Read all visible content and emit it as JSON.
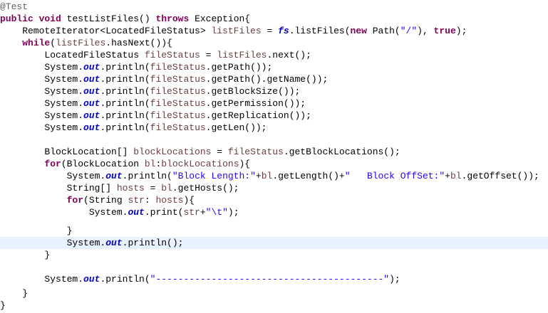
{
  "editor": {
    "highlight_line": 19,
    "lines": [
      [
        [
          "ann",
          "@Test"
        ]
      ],
      [
        [
          "kw",
          "public"
        ],
        [
          "plain",
          " "
        ],
        [
          "kw",
          "void"
        ],
        [
          "plain",
          " testListFiles() "
        ],
        [
          "kw",
          "throws"
        ],
        [
          "plain",
          " Exception{"
        ]
      ],
      [
        [
          "plain",
          "    RemoteIterator<LocatedFileStatus> "
        ],
        [
          "var",
          "listFiles"
        ],
        [
          "plain",
          " = "
        ],
        [
          "fld",
          "fs"
        ],
        [
          "plain",
          ".listFiles("
        ],
        [
          "kw",
          "new"
        ],
        [
          "plain",
          " Path("
        ],
        [
          "str",
          "\"/\""
        ],
        [
          "plain",
          "), "
        ],
        [
          "kw",
          "true"
        ],
        [
          "plain",
          ");"
        ]
      ],
      [
        [
          "plain",
          "    "
        ],
        [
          "kw",
          "while"
        ],
        [
          "plain",
          "("
        ],
        [
          "var",
          "listFiles"
        ],
        [
          "plain",
          ".hasNext()){"
        ]
      ],
      [
        [
          "plain",
          "        LocatedFileStatus "
        ],
        [
          "var",
          "fileStatus"
        ],
        [
          "plain",
          " = "
        ],
        [
          "var",
          "listFiles"
        ],
        [
          "plain",
          ".next();"
        ]
      ],
      [
        [
          "plain",
          "        System."
        ],
        [
          "fld",
          "out"
        ],
        [
          "plain",
          ".println("
        ],
        [
          "var",
          "fileStatus"
        ],
        [
          "plain",
          ".getPath());"
        ]
      ],
      [
        [
          "plain",
          "        System."
        ],
        [
          "fld",
          "out"
        ],
        [
          "plain",
          ".println("
        ],
        [
          "var",
          "fileStatus"
        ],
        [
          "plain",
          ".getPath().getName());"
        ]
      ],
      [
        [
          "plain",
          "        System."
        ],
        [
          "fld",
          "out"
        ],
        [
          "plain",
          ".println("
        ],
        [
          "var",
          "fileStatus"
        ],
        [
          "plain",
          ".getBlockSize());"
        ]
      ],
      [
        [
          "plain",
          "        System."
        ],
        [
          "fld",
          "out"
        ],
        [
          "plain",
          ".println("
        ],
        [
          "var",
          "fileStatus"
        ],
        [
          "plain",
          ".getPermission());"
        ]
      ],
      [
        [
          "plain",
          "        System."
        ],
        [
          "fld",
          "out"
        ],
        [
          "plain",
          ".println("
        ],
        [
          "var",
          "fileStatus"
        ],
        [
          "plain",
          ".getReplication());"
        ]
      ],
      [
        [
          "plain",
          "        System."
        ],
        [
          "fld",
          "out"
        ],
        [
          "plain",
          ".println("
        ],
        [
          "var",
          "fileStatus"
        ],
        [
          "plain",
          ".getLen());"
        ]
      ],
      [],
      [
        [
          "plain",
          "        BlockLocation[] "
        ],
        [
          "var",
          "blockLocations"
        ],
        [
          "plain",
          " = "
        ],
        [
          "var",
          "fileStatus"
        ],
        [
          "plain",
          ".getBlockLocations();"
        ]
      ],
      [
        [
          "plain",
          "        "
        ],
        [
          "kw",
          "for"
        ],
        [
          "plain",
          "(BlockLocation "
        ],
        [
          "var",
          "bl"
        ],
        [
          "plain",
          ":"
        ],
        [
          "var",
          "blockLocations"
        ],
        [
          "plain",
          "){"
        ]
      ],
      [
        [
          "plain",
          "            System."
        ],
        [
          "fld",
          "out"
        ],
        [
          "plain",
          ".println("
        ],
        [
          "str",
          "\"Block Length:\""
        ],
        [
          "plain",
          "+"
        ],
        [
          "var",
          "bl"
        ],
        [
          "plain",
          ".getLength()+"
        ],
        [
          "str",
          "\"   Block OffSet:\""
        ],
        [
          "plain",
          "+"
        ],
        [
          "var",
          "bl"
        ],
        [
          "plain",
          ".getOffset());"
        ]
      ],
      [
        [
          "plain",
          "            String[] "
        ],
        [
          "var",
          "hosts"
        ],
        [
          "plain",
          " = "
        ],
        [
          "var",
          "bl"
        ],
        [
          "plain",
          ".getHosts();"
        ]
      ],
      [
        [
          "plain",
          "            "
        ],
        [
          "kw",
          "for"
        ],
        [
          "plain",
          "(String "
        ],
        [
          "var",
          "str"
        ],
        [
          "plain",
          ": "
        ],
        [
          "var",
          "hosts"
        ],
        [
          "plain",
          "){"
        ]
      ],
      [
        [
          "plain",
          "                System."
        ],
        [
          "fld",
          "out"
        ],
        [
          "plain",
          ".print("
        ],
        [
          "var",
          "str"
        ],
        [
          "plain",
          "+"
        ],
        [
          "str",
          "\"\\t\""
        ],
        [
          "plain",
          ");"
        ]
      ],
      [
        [
          "plain",
          "            }"
        ]
      ],
      [
        [
          "plain",
          "            System."
        ],
        [
          "fld",
          "out"
        ],
        [
          "plain",
          ".println();"
        ]
      ],
      [
        [
          "plain",
          "        }"
        ]
      ],
      [],
      [
        [
          "plain",
          "        System."
        ],
        [
          "fld",
          "out"
        ],
        [
          "plain",
          ".println("
        ],
        [
          "str",
          "\"-----------------------------------------\""
        ],
        [
          "plain",
          ");"
        ]
      ],
      [
        [
          "plain",
          "    }"
        ]
      ],
      [
        [
          "plain",
          "}"
        ]
      ]
    ]
  }
}
